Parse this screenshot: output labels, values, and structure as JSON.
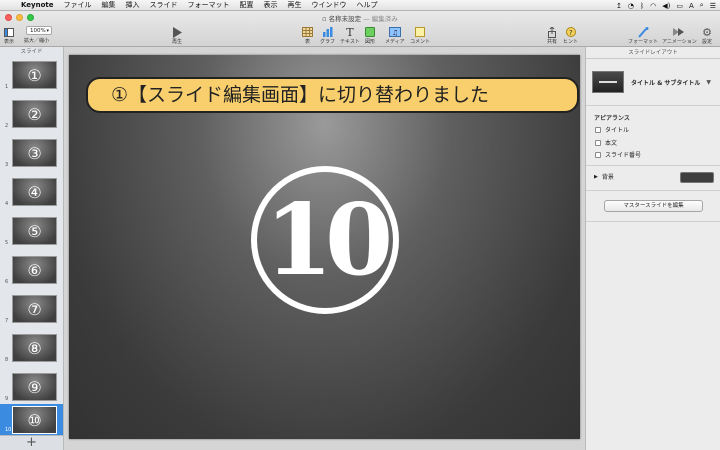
{
  "menubar": {
    "app_name": "Keynote",
    "items": [
      "ファイル",
      "編集",
      "挿入",
      "スライド",
      "フォーマット",
      "配置",
      "表示",
      "再生",
      "ウインドウ",
      "ヘルプ"
    ],
    "status": {
      "time": "3:00",
      "date": "月",
      "battery_percent": "100%"
    }
  },
  "window": {
    "title": "名称未設定",
    "status": "— 編集済み"
  },
  "toolbar": {
    "view_label": "表示",
    "zoom_value": "100%",
    "zoom_label": "拡大／縮小",
    "play_label": "再生",
    "table_label": "表",
    "chart_label": "グラフ",
    "text_label": "テキスト",
    "shape_label": "図形",
    "media_label": "メディア",
    "comment_label": "コメント",
    "share_label": "共有",
    "tips_label": "ヒント",
    "format_label": "フォーマット",
    "animate_label": "アニメーション",
    "settings_label": "設定"
  },
  "navigator": {
    "header": "スライド",
    "slides": [
      {
        "num": "1",
        "glyph": "①"
      },
      {
        "num": "2",
        "glyph": "②"
      },
      {
        "num": "3",
        "glyph": "③"
      },
      {
        "num": "4",
        "glyph": "④"
      },
      {
        "num": "5",
        "glyph": "⑤"
      },
      {
        "num": "6",
        "glyph": "⑥"
      },
      {
        "num": "7",
        "glyph": "⑦"
      },
      {
        "num": "8",
        "glyph": "⑧"
      },
      {
        "num": "9",
        "glyph": "⑨"
      },
      {
        "num": "10",
        "glyph": "⑩"
      }
    ],
    "selected_index": 9,
    "add_label": "+"
  },
  "canvas": {
    "slide_number": "10",
    "callout_text": "①【スライド編集画面】に切り替わりました"
  },
  "inspector": {
    "header": "スライドレイアウト",
    "layout_name": "タイトル & サブタイトル",
    "appearance_title": "アピアランス",
    "options": [
      "タイトル",
      "本文",
      "スライド番号"
    ],
    "background_label": "背景",
    "master_button": "マスタースライドを編集"
  },
  "colors": {
    "callout_fill": "#f8cf6c",
    "selection": "#3b8be0"
  }
}
